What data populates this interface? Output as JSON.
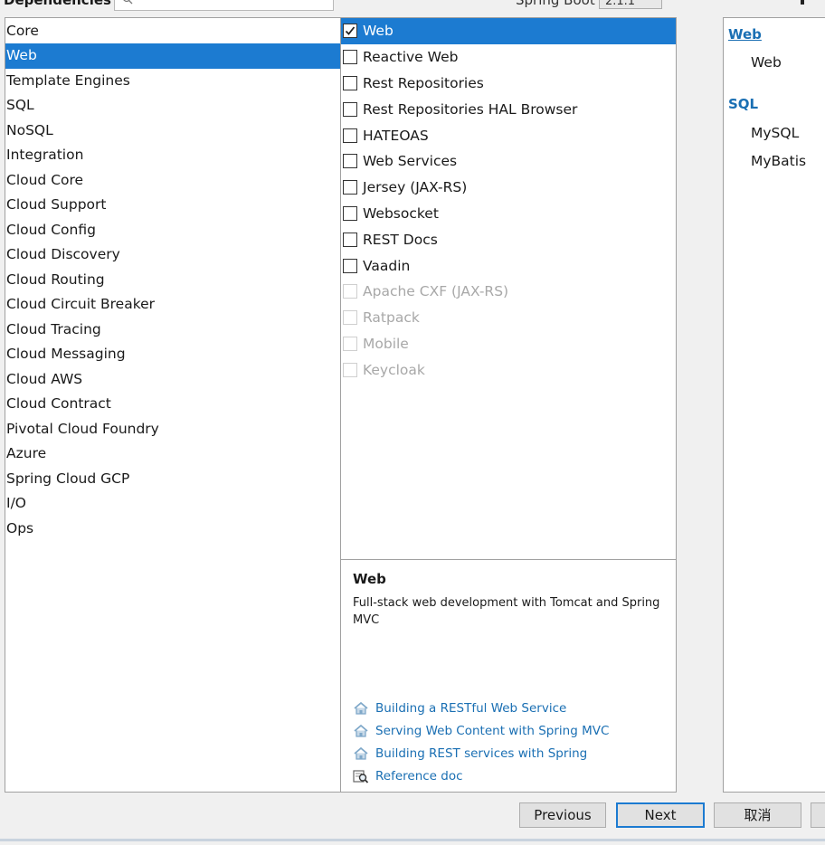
{
  "header": {
    "dependencies_label": "Dependencies",
    "spring_boot_label": "Spring Boot",
    "version_value": "2.1.1"
  },
  "categories": [
    {
      "label": "Core",
      "selected": false
    },
    {
      "label": "Web",
      "selected": true
    },
    {
      "label": "Template Engines",
      "selected": false
    },
    {
      "label": "SQL",
      "selected": false
    },
    {
      "label": "NoSQL",
      "selected": false
    },
    {
      "label": "Integration",
      "selected": false
    },
    {
      "label": "Cloud Core",
      "selected": false
    },
    {
      "label": "Cloud Support",
      "selected": false
    },
    {
      "label": "Cloud Config",
      "selected": false
    },
    {
      "label": "Cloud Discovery",
      "selected": false
    },
    {
      "label": "Cloud Routing",
      "selected": false
    },
    {
      "label": "Cloud Circuit Breaker",
      "selected": false
    },
    {
      "label": "Cloud Tracing",
      "selected": false
    },
    {
      "label": "Cloud Messaging",
      "selected": false
    },
    {
      "label": "Cloud AWS",
      "selected": false
    },
    {
      "label": "Cloud Contract",
      "selected": false
    },
    {
      "label": "Pivotal Cloud Foundry",
      "selected": false
    },
    {
      "label": "Azure",
      "selected": false
    },
    {
      "label": "Spring Cloud GCP",
      "selected": false
    },
    {
      "label": "I/O",
      "selected": false
    },
    {
      "label": "Ops",
      "selected": false
    }
  ],
  "dependencies": [
    {
      "label": "Web",
      "checked": true,
      "selected": true,
      "disabled": false
    },
    {
      "label": "Reactive Web",
      "checked": false,
      "selected": false,
      "disabled": false
    },
    {
      "label": "Rest Repositories",
      "checked": false,
      "selected": false,
      "disabled": false
    },
    {
      "label": "Rest Repositories HAL Browser",
      "checked": false,
      "selected": false,
      "disabled": false
    },
    {
      "label": "HATEOAS",
      "checked": false,
      "selected": false,
      "disabled": false
    },
    {
      "label": "Web Services",
      "checked": false,
      "selected": false,
      "disabled": false
    },
    {
      "label": "Jersey (JAX-RS)",
      "checked": false,
      "selected": false,
      "disabled": false
    },
    {
      "label": "Websocket",
      "checked": false,
      "selected": false,
      "disabled": false
    },
    {
      "label": "REST Docs",
      "checked": false,
      "selected": false,
      "disabled": false
    },
    {
      "label": "Vaadin",
      "checked": false,
      "selected": false,
      "disabled": false
    },
    {
      "label": "Apache CXF (JAX-RS)",
      "checked": false,
      "selected": false,
      "disabled": true
    },
    {
      "label": "Ratpack",
      "checked": false,
      "selected": false,
      "disabled": true
    },
    {
      "label": "Mobile",
      "checked": false,
      "selected": false,
      "disabled": true
    },
    {
      "label": "Keycloak",
      "checked": false,
      "selected": false,
      "disabled": true
    }
  ],
  "description": {
    "title": "Web",
    "text": "Full-stack web development with Tomcat and Spring MVC",
    "links": [
      {
        "label": "Building a RESTful Web Service",
        "icon": "home-icon"
      },
      {
        "label": "Serving Web Content with Spring MVC",
        "icon": "home-icon"
      },
      {
        "label": "Building REST services with Spring",
        "icon": "home-icon"
      },
      {
        "label": "Reference doc",
        "icon": "reference-doc-icon"
      }
    ]
  },
  "selected_dependencies": {
    "groups": [
      {
        "name": "Web",
        "items": [
          "Web"
        ]
      },
      {
        "name": "SQL",
        "items": [
          "MySQL",
          "MyBatis"
        ]
      }
    ]
  },
  "buttons": {
    "previous": "Previous",
    "next": "Next",
    "cancel": "取消"
  },
  "colors": {
    "selection": "#1c7bd1",
    "link": "#1a6fb3",
    "disabled_text": "#a8a8a8"
  }
}
